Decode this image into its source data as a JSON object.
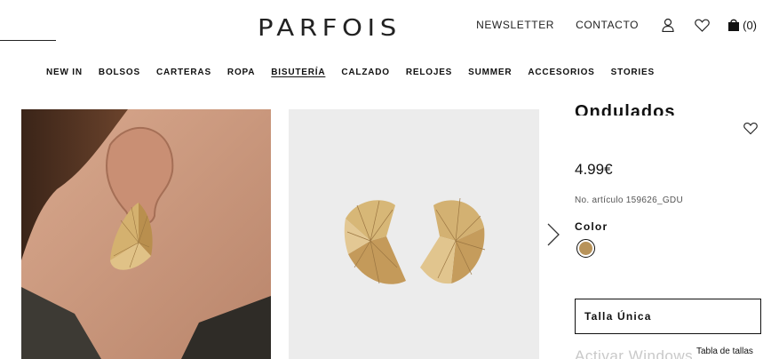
{
  "header": {
    "logo": "PARFOIS",
    "links": [
      "NEWSLETTER",
      "CONTACTO"
    ],
    "cart_count": "(0)",
    "icons": [
      "user-icon",
      "heart-icon",
      "bag-icon"
    ]
  },
  "nav": {
    "items": [
      "NEW IN",
      "BOLSOS",
      "CARTERAS",
      "ROPA",
      "BISUTERÍA",
      "CALZADO",
      "RELOJES",
      "SUMMER",
      "ACCESORIOS",
      "STORIES"
    ],
    "active": "BISUTERÍA"
  },
  "product": {
    "title_fragment": "Ondulados",
    "price": "4.99€",
    "article": "No. artículo 159626_GDU",
    "color_label": "Color",
    "color_swatch": "#b8935a",
    "size_label": "Talla Única",
    "size_table_link": "Tabla de tallas"
  },
  "overlay": {
    "watermark": "Activar Windows"
  },
  "colors": {
    "text": "#111111",
    "gold": "#c9a063",
    "product_bg": "#ececec"
  }
}
